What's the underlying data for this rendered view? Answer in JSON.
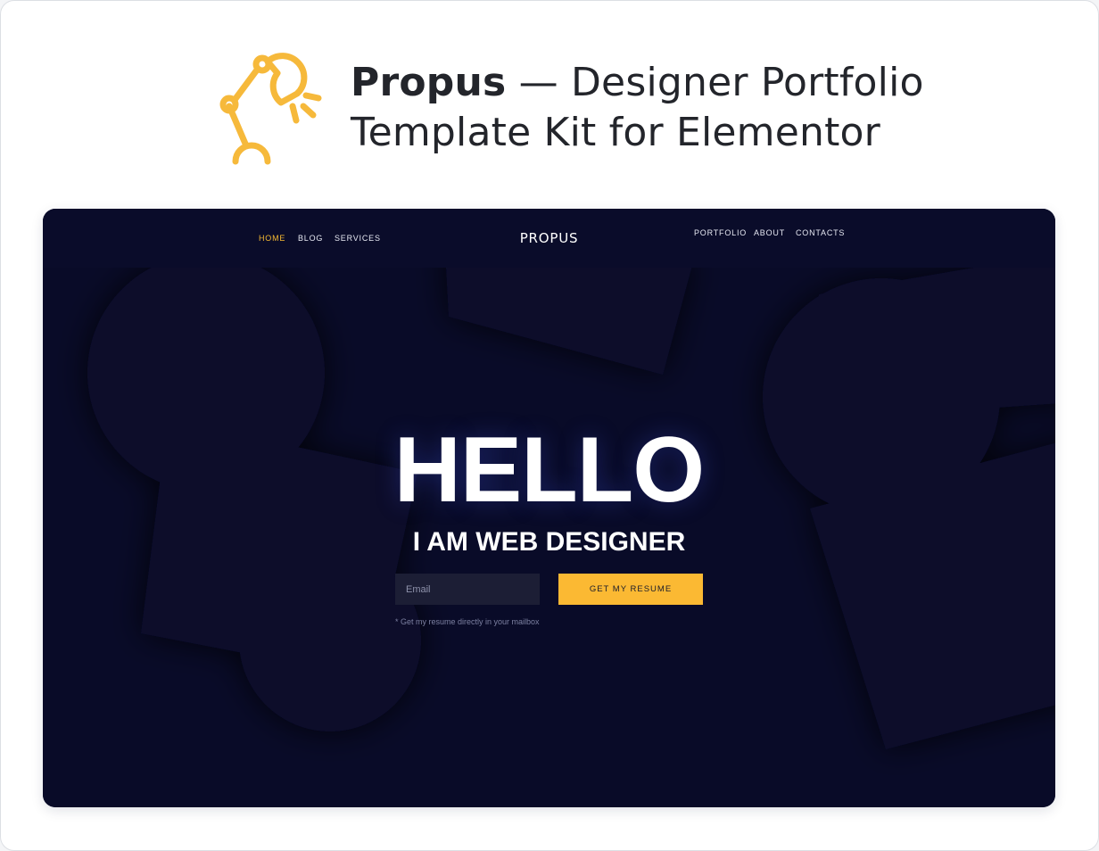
{
  "header": {
    "title_name": "Propus",
    "title_rest_line1": " — Designer Portfolio",
    "title_line2": "Template Kit for Elementor",
    "logo_icon": "desk-lamp-icon",
    "logo_color": "#F6B93B"
  },
  "preview": {
    "nav": {
      "left_items": [
        {
          "label": "HOME",
          "active": true
        },
        {
          "label": "BLOG",
          "active": false
        },
        {
          "label": "SERVICES",
          "active": false
        }
      ],
      "logo": "PROPUS",
      "right_items": [
        {
          "label": "PORTFOLIO",
          "active": false
        },
        {
          "label": "ABOUT",
          "active": false
        },
        {
          "label": "CONTACTS",
          "active": false
        }
      ]
    },
    "hero": {
      "title": "HELLO",
      "subtitle": "I AM WEB DESIGNER",
      "email_placeholder": "Email",
      "button_label": "GET MY RESUME",
      "hint": "* Get my resume directly in your mailbox"
    },
    "colors": {
      "background": "#090B28",
      "accent": "#FBB933",
      "active_nav": "#F5B932"
    }
  }
}
